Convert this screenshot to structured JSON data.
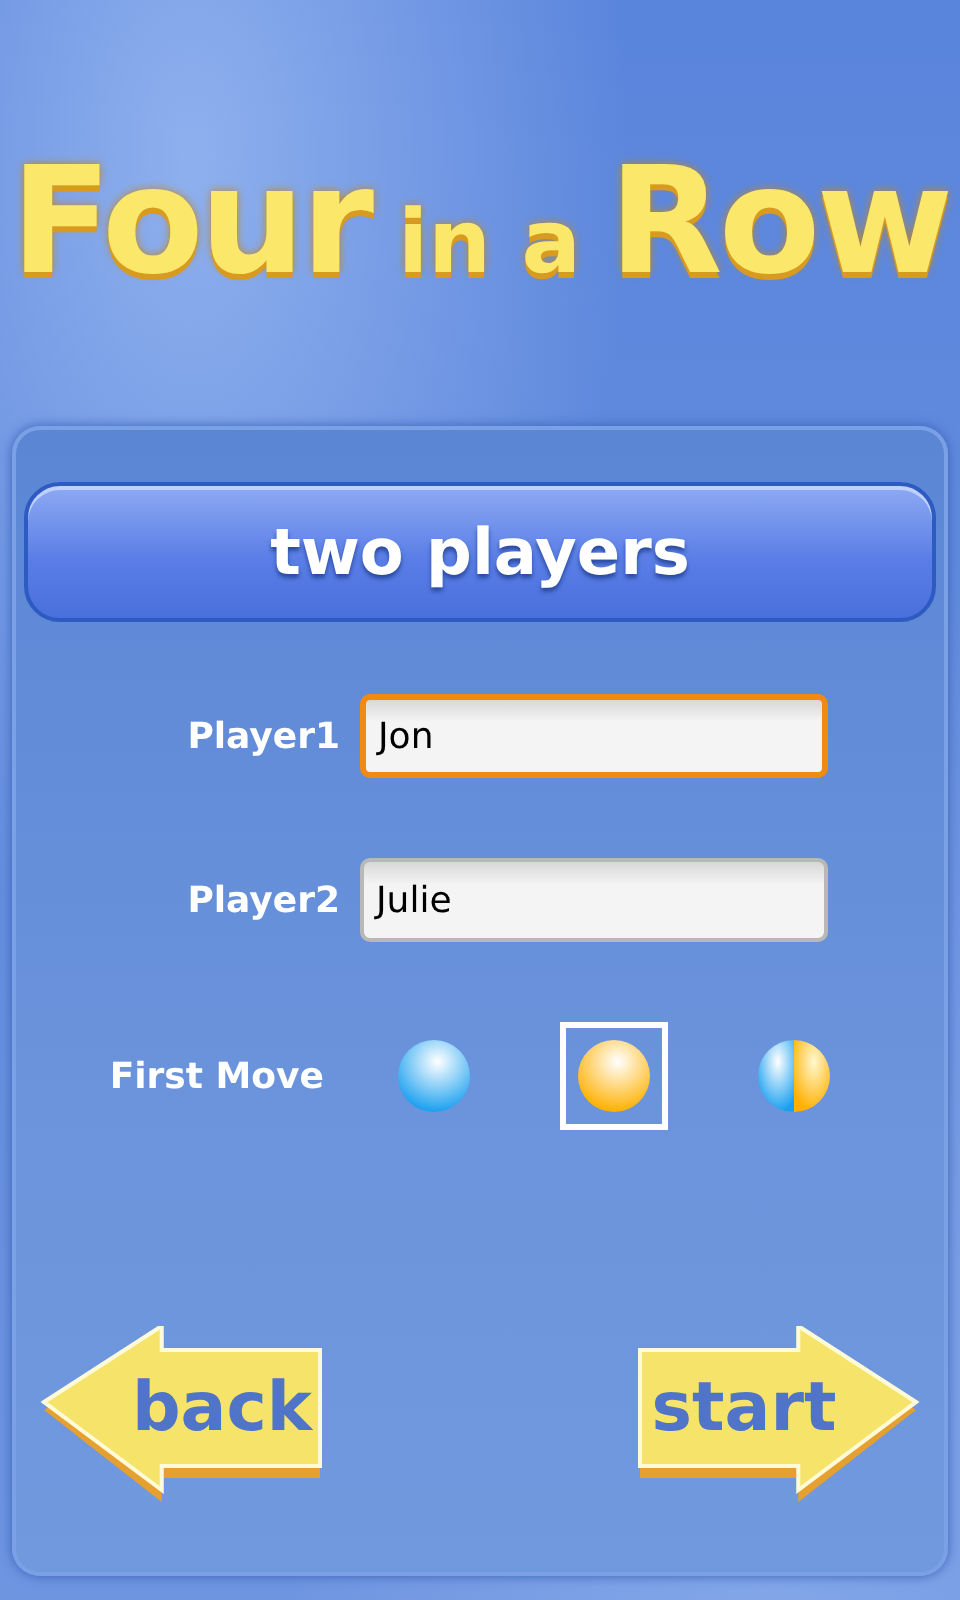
{
  "title": [
    {
      "text": "Four",
      "kind": "big"
    },
    {
      "text": "in a",
      "kind": "small"
    },
    {
      "text": "Row",
      "kind": "big"
    }
  ],
  "mode_button": "two players",
  "players": [
    {
      "label": "Player1",
      "value": "Jon",
      "focused": true
    },
    {
      "label": "Player2",
      "value": "Julie",
      "focused": false
    }
  ],
  "first_move": {
    "label": "First Move",
    "options": [
      {
        "kind": "blue",
        "selected": false
      },
      {
        "kind": "yellow",
        "selected": true
      },
      {
        "kind": "random",
        "selected": false
      }
    ]
  },
  "back_button": "back",
  "start_button": "start"
}
